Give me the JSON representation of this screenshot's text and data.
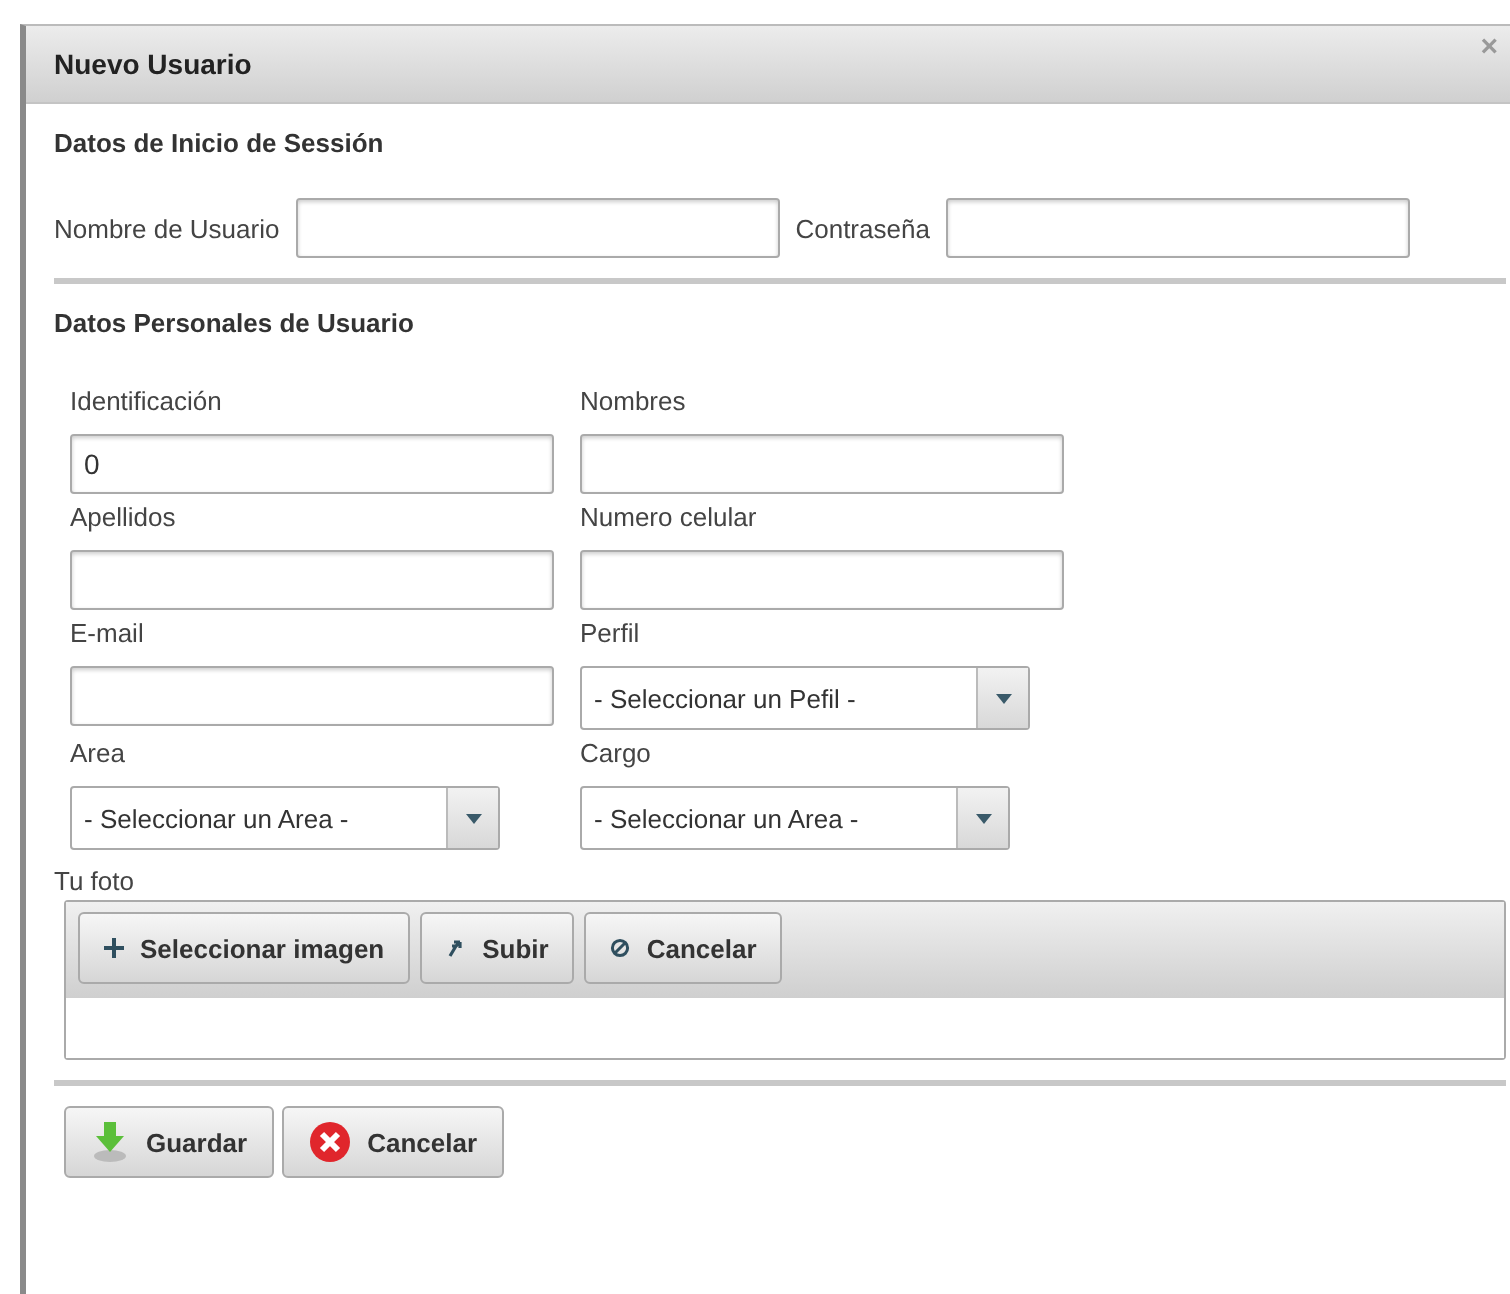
{
  "dialog": {
    "title": "Nuevo Usuario",
    "close": "×"
  },
  "login": {
    "heading": "Datos de Inicio de Sessión",
    "fields": [
      {
        "label": "Nombre de Usuario"
      },
      {
        "label": "Contraseña"
      }
    ]
  },
  "personal": {
    "heading": "Datos Personales de Usuario",
    "fields": [
      {
        "kind": "text",
        "label": "Identificación",
        "value": "0"
      },
      {
        "kind": "text",
        "label": "Nombres"
      },
      {
        "kind": "text",
        "label": "Apellidos"
      },
      {
        "kind": "text",
        "label": "Numero celular"
      },
      {
        "kind": "text",
        "label": "E-mail"
      },
      {
        "kind": "select",
        "label": "Perfil",
        "value": "- Seleccionar un Pefil -"
      },
      {
        "kind": "select",
        "label": "Area",
        "value": "- Seleccionar un Area -"
      },
      {
        "kind": "select",
        "label": "Cargo",
        "value": "- Seleccionar un Area -"
      }
    ]
  },
  "photo": {
    "label": "Tu foto",
    "buttons": [
      {
        "kind": "add",
        "label": "Seleccionar imagen"
      },
      {
        "kind": "upload",
        "label": "Subir"
      },
      {
        "kind": "cancel",
        "label": "Cancelar"
      }
    ]
  },
  "actions": [
    {
      "kind": "save",
      "label": "Guardar"
    },
    {
      "kind": "cancel",
      "label": "Cancelar"
    }
  ]
}
